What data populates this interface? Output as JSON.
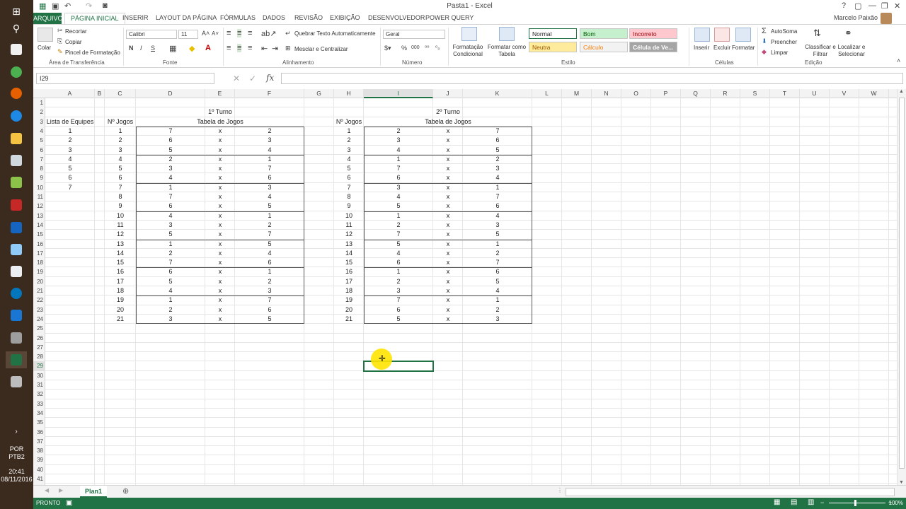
{
  "window": {
    "title": "Pasta1 - Excel",
    "user": "Marcelo Paixão",
    "controls": [
      "?",
      "▢",
      "—",
      "❐",
      "✕"
    ]
  },
  "tabs": {
    "file": "ARQUIVO",
    "items": [
      "PÁGINA INICIAL",
      "INSERIR",
      "LAYOUT DA PÁGINA",
      "FÓRMULAS",
      "DADOS",
      "REVISÃO",
      "EXIBIÇÃO",
      "DESENVOLVEDOR",
      "POWER QUERY"
    ],
    "active_index": 0
  },
  "ribbon": {
    "clipboard": {
      "label": "Área de Transferência",
      "paste": "Colar",
      "cut": "Recortar",
      "copy": "Copiar",
      "format_painter": "Pincel de Formatação"
    },
    "font": {
      "label": "Fonte",
      "name": "Calibri",
      "size": "11",
      "bold": "N",
      "italic": "I",
      "underline": "S"
    },
    "alignment": {
      "label": "Alinhamento",
      "wrap": "Quebrar Texto Automaticamente",
      "merge": "Mesclar e Centralizar"
    },
    "number": {
      "label": "Número",
      "format": "Geral",
      "percent": "%",
      "thousands": "000"
    },
    "styles": {
      "label": "Estilo",
      "cond_format": "Formatação Condicional",
      "format_table": "Formatar como Tabela",
      "cells": [
        {
          "name": "Normal",
          "bg": "#ffffff",
          "fg": "#222222"
        },
        {
          "name": "Bom",
          "bg": "#c6efce",
          "fg": "#006100"
        },
        {
          "name": "Incorreto",
          "bg": "#ffc7ce",
          "fg": "#9c0006"
        },
        {
          "name": "Neutra",
          "bg": "#ffeb9c",
          "fg": "#9c5700"
        },
        {
          "name": "Cálculo",
          "bg": "#f2f2f2",
          "fg": "#fa7d00"
        },
        {
          "name": "Célula de Ve...",
          "bg": "#a5a5a5",
          "fg": "#ffffff"
        }
      ]
    },
    "cells": {
      "label": "Células",
      "insert": "Inserir",
      "delete": "Excluir",
      "format": "Formatar"
    },
    "editing": {
      "label": "Edição",
      "autosum": "AutoSoma",
      "fill": "Preencher",
      "clear": "Limpar",
      "sort": "Classificar e Filtrar",
      "find": "Localizar e Selecionar"
    }
  },
  "formula_bar": {
    "name_box": "I29",
    "fx": "fx",
    "content": ""
  },
  "columns": [
    "A",
    "B",
    "C",
    "D",
    "E",
    "F",
    "G",
    "H",
    "I",
    "J",
    "K",
    "L",
    "M",
    "N",
    "O",
    "P",
    "Q",
    "R",
    "S",
    "T",
    "U",
    "V",
    "W"
  ],
  "selected_column": "I",
  "selected_row": 29,
  "rows_count": 41,
  "sheet": {
    "turno1_title": "1º Turno",
    "turno2_title": "2º Turno",
    "tabela_label": "Tabela de Jogos",
    "lista_label": "Lista de Equipes",
    "njogos_label": "Nº Jogos",
    "equipes": [
      "1",
      "2",
      "3",
      "4",
      "5",
      "6",
      "7"
    ],
    "turno1": [
      [
        "1",
        "7",
        "2"
      ],
      [
        "2",
        "6",
        "3"
      ],
      [
        "3",
        "5",
        "4"
      ],
      [
        "4",
        "2",
        "1"
      ],
      [
        "5",
        "3",
        "7"
      ],
      [
        "6",
        "4",
        "6"
      ],
      [
        "7",
        "1",
        "3"
      ],
      [
        "8",
        "7",
        "4"
      ],
      [
        "9",
        "6",
        "5"
      ],
      [
        "10",
        "4",
        "1"
      ],
      [
        "11",
        "3",
        "2"
      ],
      [
        "12",
        "5",
        "7"
      ],
      [
        "13",
        "1",
        "5"
      ],
      [
        "14",
        "2",
        "4"
      ],
      [
        "15",
        "7",
        "6"
      ],
      [
        "16",
        "6",
        "1"
      ],
      [
        "17",
        "5",
        "2"
      ],
      [
        "18",
        "4",
        "3"
      ],
      [
        "19",
        "1",
        "7"
      ],
      [
        "20",
        "2",
        "6"
      ],
      [
        "21",
        "3",
        "5"
      ]
    ],
    "turno2": [
      [
        "1",
        "2",
        "7"
      ],
      [
        "2",
        "3",
        "6"
      ],
      [
        "3",
        "4",
        "5"
      ],
      [
        "4",
        "1",
        "2"
      ],
      [
        "5",
        "7",
        "3"
      ],
      [
        "6",
        "6",
        "4"
      ],
      [
        "7",
        "3",
        "1"
      ],
      [
        "8",
        "4",
        "7"
      ],
      [
        "9",
        "5",
        "6"
      ],
      [
        "10",
        "1",
        "4"
      ],
      [
        "11",
        "2",
        "3"
      ],
      [
        "12",
        "7",
        "5"
      ],
      [
        "13",
        "5",
        "1"
      ],
      [
        "14",
        "4",
        "2"
      ],
      [
        "15",
        "6",
        "7"
      ],
      [
        "16",
        "1",
        "6"
      ],
      [
        "17",
        "2",
        "5"
      ],
      [
        "18",
        "3",
        "4"
      ],
      [
        "19",
        "7",
        "1"
      ],
      [
        "20",
        "6",
        "2"
      ],
      [
        "21",
        "5",
        "3"
      ]
    ],
    "vs": "x"
  },
  "sheet_tab": "Plan1",
  "status": {
    "ready": "PRONTO",
    "zoom": "100%"
  },
  "taskbar": {
    "lang1": "POR",
    "lang2": "PTB2",
    "time": "20:41",
    "date": "08/11/2016"
  }
}
